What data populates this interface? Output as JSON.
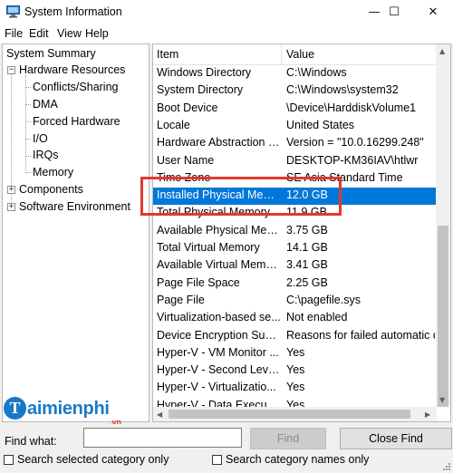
{
  "window": {
    "title": "System Information",
    "controls": {
      "minimize": "—",
      "maximize": "☐",
      "close": "✕"
    }
  },
  "menu": [
    "File",
    "Edit",
    "View",
    "Help"
  ],
  "tree": {
    "root": "System Summary",
    "hardware": "Hardware Resources",
    "hardware_children": [
      "Conflicts/Sharing",
      "DMA",
      "Forced Hardware",
      "I/O",
      "IRQs",
      "Memory"
    ],
    "components": "Components",
    "software": "Software Environment"
  },
  "list": {
    "headers": {
      "item": "Item",
      "value": "Value"
    },
    "rows": [
      {
        "item": "Windows Directory",
        "value": "C:\\Windows"
      },
      {
        "item": "System Directory",
        "value": "C:\\Windows\\system32"
      },
      {
        "item": "Boot Device",
        "value": "\\Device\\HarddiskVolume1"
      },
      {
        "item": "Locale",
        "value": "United States"
      },
      {
        "item": "Hardware Abstraction L...",
        "value": "Version = \"10.0.16299.248\""
      },
      {
        "item": "User Name",
        "value": "DESKTOP-KM36IAV\\htlwr"
      },
      {
        "item": "Time Zone",
        "value": "SE Asia Standard Time"
      },
      {
        "item": "Installed Physical Mem...",
        "value": "12.0 GB"
      },
      {
        "item": "Total Physical Memory",
        "value": "11.9 GB"
      },
      {
        "item": "Available Physical Mem...",
        "value": "3.75 GB"
      },
      {
        "item": "Total Virtual Memory",
        "value": "14.1 GB"
      },
      {
        "item": "Available Virtual Memory",
        "value": "3.41 GB"
      },
      {
        "item": "Page File Space",
        "value": "2.25 GB"
      },
      {
        "item": "Page File",
        "value": "C:\\pagefile.sys"
      },
      {
        "item": "Virtualization-based se...",
        "value": "Not enabled"
      },
      {
        "item": "Device Encryption Supp...",
        "value": "Reasons for failed automatic d"
      },
      {
        "item": "Hyper-V - VM Monitor ...",
        "value": "Yes"
      },
      {
        "item": "Hyper-V - Second Level...",
        "value": "Yes"
      },
      {
        "item": "Hyper-V - Virtualizatio...",
        "value": "Yes"
      },
      {
        "item": "Hyper-V - Data Executi...",
        "value": "Yes"
      }
    ],
    "selected_row": "Installed Physical Mem..."
  },
  "watermark": {
    "initial": "T",
    "name": "aimienphi",
    "suffix": ".vn"
  },
  "find": {
    "label": "Find what:",
    "value": "",
    "find_button": "Find",
    "close_find_button": "Close Find",
    "option_selected_category": "Search selected category only",
    "option_category_names": "Search category names only"
  },
  "colors": {
    "selection": "#0078d7",
    "highlight_box": "#e0392f",
    "watermark": "#1a79c6"
  }
}
